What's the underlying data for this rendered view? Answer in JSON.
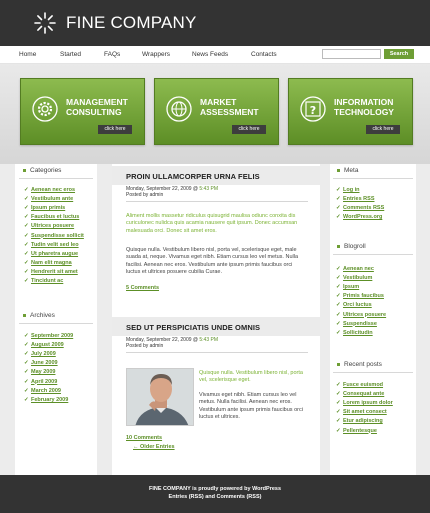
{
  "brand": "FINE COMPANY",
  "nav": [
    "Home",
    "Started",
    "FAQs",
    "Wrappers",
    "News Feeds",
    "Contacts"
  ],
  "search": {
    "button": "Search"
  },
  "banners": [
    {
      "line1": "MANAGEMENT",
      "line2": "CONSULTING",
      "button": "click here",
      "icon": "gear-icon"
    },
    {
      "line1": "MARKET",
      "line2": "ASSESSMENT",
      "button": "click here",
      "icon": "globe-icon"
    },
    {
      "line1": "INFORMATION",
      "line2": "TECHNOLOGY",
      "button": "click here",
      "icon": "question-icon"
    }
  ],
  "left": {
    "categories_title": "Categories",
    "categories": [
      "Aenean nec eros",
      "Vestibulum ante",
      "Ipsum primis",
      "Faucibus et luctus",
      "Ultrices posuere",
      "Suspendisse sollicit",
      "Tudin velit sed leo",
      "Ut pharetra augue",
      "Nam elit magna",
      "Hendrerit sit amet",
      "Tincidunt ac"
    ],
    "archives_title": "Archives",
    "archives": [
      "September 2009",
      "August 2009",
      "July 2009",
      "June 2009",
      "May 2009",
      "April 2009",
      "March 2009",
      "February 2009"
    ]
  },
  "right": {
    "meta_title": "Meta",
    "meta": [
      "Log in",
      "Entries RSS",
      "Comments RSS",
      "WordPress.org"
    ],
    "blogroll_title": "Blogroll",
    "blogroll": [
      "Aenean nec",
      "Vestibulum",
      "Ipsum",
      "Primis faucibus",
      "Orci luctus",
      "Ultrices posuere",
      "Suspendisse",
      "Sollicitudin"
    ],
    "recent_title": "Recent posts",
    "recent": [
      "Fusce euismod",
      "Consequat ante",
      "Lorem ipsum dolor",
      "Sit amet consect",
      "Etur adipiscing",
      "Pellentesque"
    ]
  },
  "posts": [
    {
      "title": "PROIN ULLAMCORPER URNA FELIS",
      "date_prefix": "Monday, September 22, 2009 @",
      "time": "5:43 PM",
      "posted_by": "Posted by admin",
      "lead": "Aliment mollis massetur ridiculus quisugrid maulisa odiunc conxita dis curiculonec nulidca quis acamia nausere quit ipsum. Donec accumsan malesuada orci. Donec sit amet eros.",
      "body": "Quisque nulla. Vestibulum libero nisl, porta vel, scelerisque eget, male suada at, neque. Vivamus eget nibh. Etiam cursus leo vel metus. Nulla facilisi. Aenean nec eros. Vestibulum ante ipsum primis faucibus orci luctus et ultrices posuere cubilia Curae.",
      "comments": "5 Comments"
    },
    {
      "title": "SED UT PERSPICIATIS UNDE OMNIS",
      "date_prefix": "Monday, September 22, 2009 @",
      "time": "5:43 PM",
      "posted_by": "Posted by admin",
      "lead": "Quisque nulla. Vestibulum libero nisl, porta vel, scelerisque eget.",
      "body": "Vivamus eget nibh. Etiam cursus leo vel metus. Nulla facilisi. Aenean nec eros. Vestibulum ante ipsum primis faucibus orci luctus et ultrices.",
      "comments": "10 Comments",
      "older": "← Older Entries"
    }
  ],
  "footer": {
    "line1": "FINE COMPANY is proudly powered by WordPress",
    "line2": "Entries (RSS) and Comments (RSS)"
  },
  "colors": {
    "accent": "#6e9e35",
    "dark": "#333333",
    "link": "#5c8f26"
  }
}
